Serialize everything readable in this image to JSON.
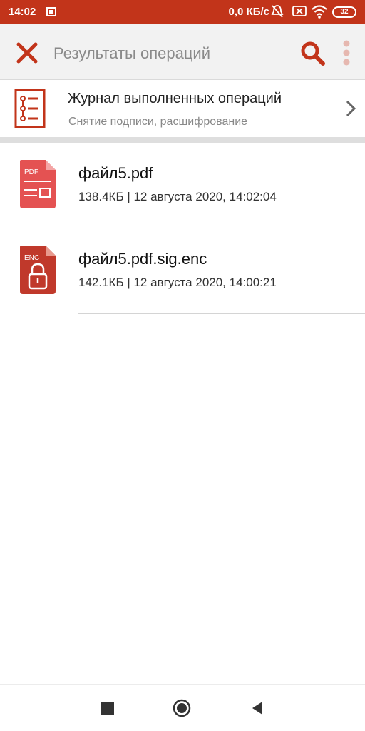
{
  "status_bar": {
    "time": "14:02",
    "network_speed": "0,0 КБ/с",
    "battery": "32",
    "icons": [
      "notification-icon",
      "mute-icon",
      "sim-icon",
      "wifi-icon",
      "battery-icon"
    ]
  },
  "app_bar": {
    "title": "Результаты операций",
    "icons": [
      "close-icon",
      "search-icon",
      "more-icon"
    ]
  },
  "journal": {
    "title": "Журнал выполненных операций",
    "subtitle": "Снятие подписи, расшифрование",
    "icon": "journal-icon"
  },
  "files": [
    {
      "name": "файл5.pdf",
      "meta": "138.4КБ | 12 августа 2020, 14:02:04",
      "type_label": "PDF",
      "icon": "pdf-file-icon"
    },
    {
      "name": "файл5.pdf.sig.enc",
      "meta": "142.1КБ | 12 августа 2020, 14:00:21",
      "type_label": "ENC",
      "icon": "enc-file-icon"
    }
  ],
  "colors": {
    "accent": "#c2341a",
    "pdf": "#e45252",
    "enc": "#c0392b"
  },
  "nav_bar": {
    "icons": [
      "recent-apps-icon",
      "home-icon",
      "back-icon"
    ]
  }
}
